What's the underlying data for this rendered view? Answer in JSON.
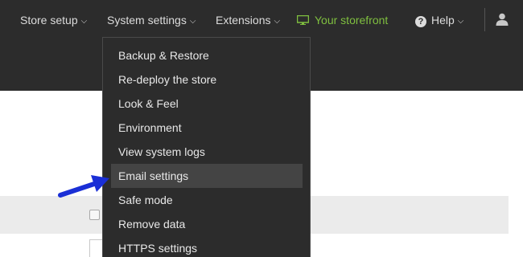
{
  "nav": {
    "store_setup": "Store setup",
    "system_settings": "System settings",
    "extensions": "Extensions",
    "storefront": "Your storefront",
    "help": "Help",
    "chevron": "⌵",
    "help_glyph": "?"
  },
  "dropdown": {
    "items": [
      {
        "label": "Backup & Restore"
      },
      {
        "label": "Re-deploy the store"
      },
      {
        "label": "Look & Feel"
      },
      {
        "label": "Environment"
      },
      {
        "label": "View system logs"
      },
      {
        "label": "Email settings",
        "highlighted": true
      },
      {
        "label": "Safe mode"
      },
      {
        "label": "Remove data"
      },
      {
        "label": "HTTPS settings"
      }
    ]
  },
  "colors": {
    "topbar": "#2c2c2c",
    "storefront": "#7fbf3f",
    "arrow": "#1a2fd6",
    "highlight": "#444444"
  },
  "icons": [
    "chevron-down-icon",
    "monitor-icon",
    "help-icon",
    "user-icon",
    "pointer-arrow-icon"
  ]
}
